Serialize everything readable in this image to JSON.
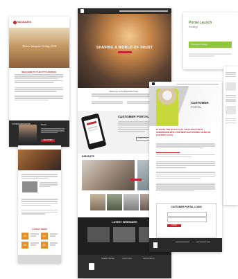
{
  "card1": {
    "logo": "MASSAGES",
    "hero_title": "Eeuro Imagine Going 2019",
    "welcome": "WELCOME TO THE FITTS EDITION",
    "speaker_label": "CLOSING EDUCATOR",
    "speaker_name": "David",
    "cta": "REGISTER"
  },
  "card2": {
    "hero_title": "SHAPING A WORLD OF TRUST",
    "welcome": "Welcome to the Business Trust...",
    "portal_title": "CUSTOMER PORTAL",
    "portal_btn": "LEARN MORE",
    "insights": "INSIGHTS",
    "webinars": "LATEST WEBINARS",
    "footer_cols": [
      "BUREAU VERITAS",
      "QUICK LINKS",
      "CERTIFICATION"
    ]
  },
  "card3": {
    "title": "Portal Launch",
    "subtitle": "Strategy",
    "bar_text": "Portal Launch Strategy"
  },
  "card4": {
    "portal_label": "CUSTOMER",
    "portal_label2": "PORTAL",
    "headline": "ELEVATE THE QUALITY OF YOUR ANALYTICAL SUBMISSION WITH OUR NEW ELECTRONIC CHAIN OF CUSTODY (COC)",
    "login_title": "CUSTOMER PORTAL LOGIN",
    "login_btn": "LOGIN"
  },
  "card5": {
    "header": "LATEST NEWS",
    "dates": [
      "24",
      "24",
      "24",
      "24"
    ]
  },
  "colors": {
    "brand_red": "#c0252f",
    "dark": "#1f1f1f",
    "green": "#8fc63f"
  }
}
